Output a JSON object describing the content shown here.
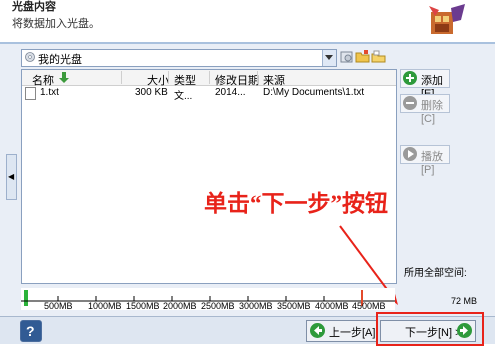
{
  "header": {
    "title": "光盘内容",
    "subtitle": "将数据加入光盘。"
  },
  "disc_selector": {
    "value": "我的光盘"
  },
  "file_list": {
    "columns": [
      "名称",
      "大小",
      "类型",
      "修改日期",
      "来源"
    ],
    "rows": [
      {
        "name": "1.txt",
        "size": "300 KB",
        "type": "文...",
        "modified": "2014...",
        "source": "D:\\My Documents\\1.txt"
      }
    ]
  },
  "side_buttons": {
    "add": "添加[E]...",
    "delete": "删除[C]",
    "play": "播放[P]"
  },
  "annotation": "单击“下一步”按钮",
  "capacity": {
    "label": "所用全部空间:",
    "used": "72 MB",
    "ticks": [
      "500MB",
      "1000MB",
      "1500MB",
      "2000MB",
      "2500MB",
      "3000MB",
      "3500MB",
      "4000MB",
      "4500MB"
    ]
  },
  "footer": {
    "help": "?",
    "back": "上一步[A]",
    "next": "下一步[N] >"
  },
  "colors": {
    "accent_red": "#e8231a",
    "border_blue": "#8aa0bf",
    "go_green": "#2e9a3b"
  }
}
